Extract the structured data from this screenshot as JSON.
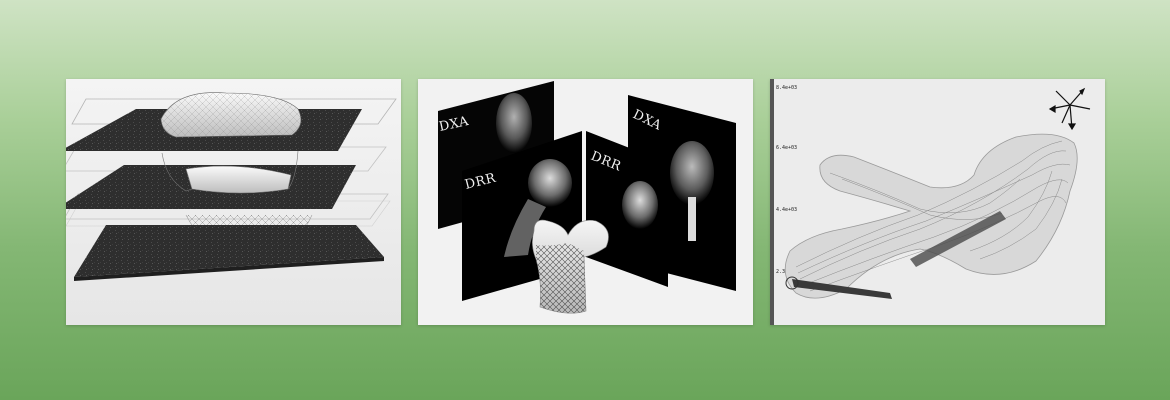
{
  "panels": [
    {
      "id": "ct-slices"
    },
    {
      "id": "dxa-drr",
      "labels": [
        "DXA",
        "DRR",
        "DRR",
        "DXA"
      ]
    },
    {
      "id": "streamlines",
      "ticks": [
        "8.4e+03",
        "6.4e+03",
        "4.4e+03",
        "2.3e+03"
      ]
    }
  ],
  "colors": {
    "background_top": "#cfe3c4",
    "background_bottom": "#6aa55a",
    "panel": "#f2f2f2",
    "slice": "#2b2b2b"
  }
}
